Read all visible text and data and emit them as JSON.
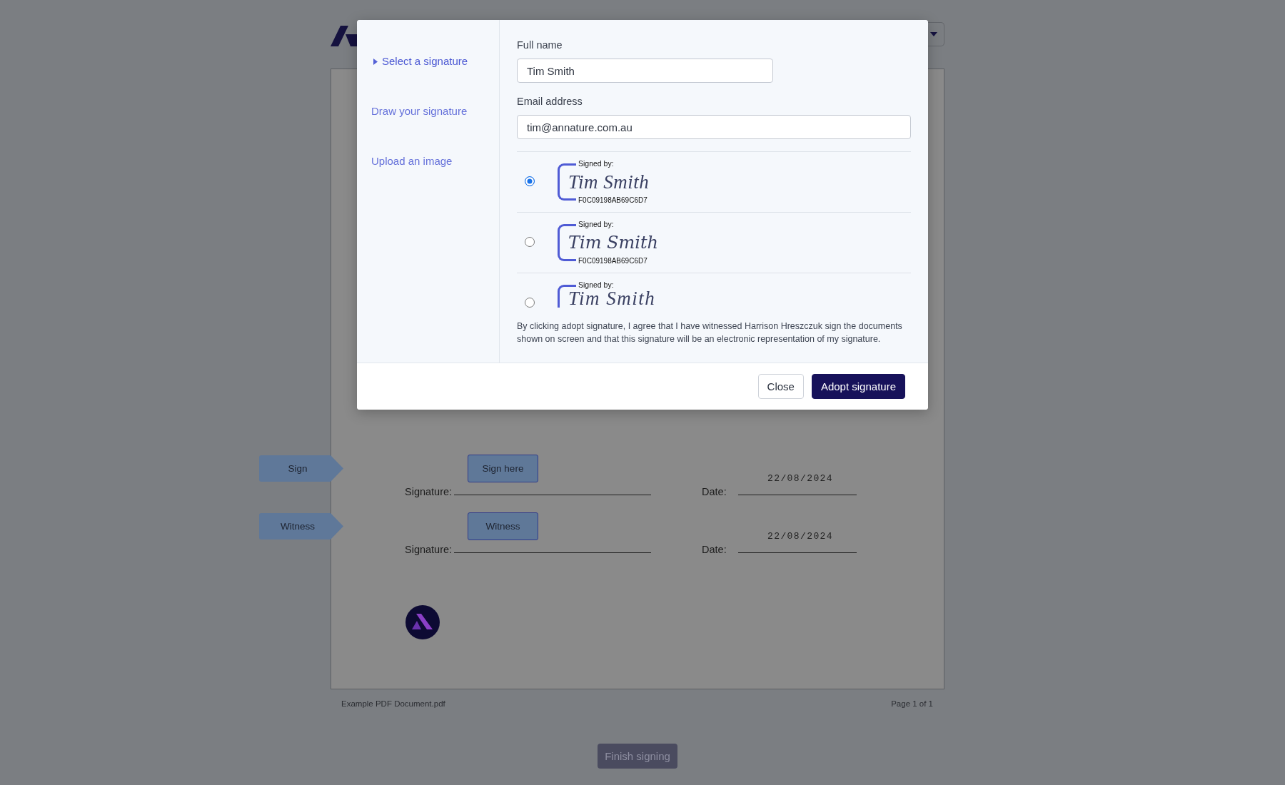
{
  "modal": {
    "nav": [
      {
        "label": "Select a signature",
        "selected": true
      },
      {
        "label": "Draw your signature",
        "selected": false
      },
      {
        "label": "Upload an image",
        "selected": false
      }
    ],
    "fields": [
      {
        "label": "Full name",
        "value": "Tim Smith"
      },
      {
        "label": "Email address",
        "value": "tim@annature.com.au"
      }
    ],
    "signature_options": [
      {
        "selected": true,
        "signed_by": "Signed by:",
        "signature": "Tim Smith",
        "hash": "F0C09198AB69C6D7"
      },
      {
        "selected": false,
        "signed_by": "Signed by:",
        "signature": "Tim Smith",
        "hash": "F0C09198AB69C6D7"
      },
      {
        "selected": false,
        "signed_by": "Signed by:",
        "signature": "Tim Smith"
      }
    ],
    "consent": "By clicking adopt signature, I agree that I have witnessed Harrison Hreszczuk sign the documents shown on screen and that this signature will be an electronic representation of my signature.",
    "buttons": [
      {
        "label": "Close",
        "kind": "secondary"
      },
      {
        "label": "Adopt signature",
        "kind": "primary"
      }
    ]
  },
  "document": {
    "fields": [
      {
        "tag": "Sign",
        "field_box": "Sign here",
        "signature_label": "Signature:",
        "date_label": "Date:",
        "date": "22/08/2024"
      },
      {
        "tag": "Witness",
        "field_box": "Witness",
        "signature_label": "Signature:",
        "date_label": "Date:",
        "date": "22/08/2024"
      }
    ],
    "file_name": "Example PDF Document.pdf",
    "page": "Page 1 of 1"
  },
  "finish_button": {
    "label": "Finish signing",
    "disabled": true
  }
}
